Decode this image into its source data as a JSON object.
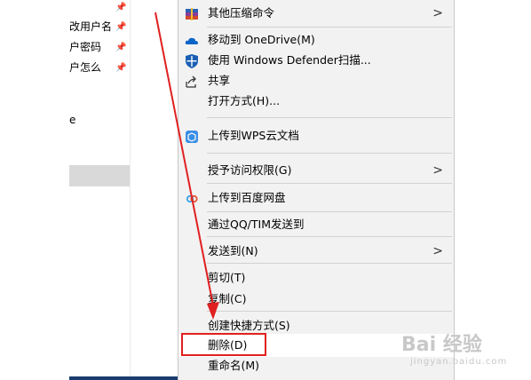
{
  "explorer": {
    "quick_access": [
      {
        "label": "",
        "pinned": true
      },
      {
        "label": "改用户名",
        "pinned": true
      },
      {
        "label": "户密码",
        "pinned": true
      },
      {
        "label": "户怎么",
        "pinned": true
      }
    ],
    "partial_item": "e"
  },
  "menu": {
    "items": [
      {
        "label": "其他压缩命令",
        "icon": "archive-icon",
        "submenu": true
      },
      {
        "label": "移动到 OneDrive(M)",
        "icon": "onedrive-cloud-icon",
        "submenu": false
      },
      {
        "label": "使用 Windows Defender扫描...",
        "icon": "defender-shield-icon",
        "submenu": false
      },
      {
        "label": "共享",
        "icon": "share-icon",
        "submenu": false
      },
      {
        "label": "打开方式(H)...",
        "icon": "",
        "submenu": false
      },
      {
        "label": "上传到WPS云文档",
        "icon": "wps-cloud-icon",
        "submenu": false
      },
      {
        "label": "授予访问权限(G)",
        "icon": "",
        "submenu": true
      },
      {
        "label": "上传到百度网盘",
        "icon": "baidu-netdisk-icon",
        "submenu": false
      },
      {
        "label": "通过QQ/TIM发送到",
        "icon": "",
        "submenu": false
      },
      {
        "label": "发送到(N)",
        "icon": "",
        "submenu": true
      },
      {
        "label": "剪切(T)",
        "icon": "",
        "submenu": false
      },
      {
        "label": "复制(C)",
        "icon": "",
        "submenu": false
      },
      {
        "label": "创建快捷方式(S)",
        "icon": "",
        "submenu": false
      },
      {
        "label": "删除(D)",
        "icon": "",
        "submenu": false
      },
      {
        "label": "重命名(M)",
        "icon": "",
        "submenu": false
      }
    ],
    "submenu_arrow": ">"
  },
  "annotation": {
    "color": "#e02020",
    "target": "删除(D)"
  },
  "watermark": {
    "text": "Bai 经验",
    "sub": "jingyan.baidu.com"
  },
  "colors": {
    "menu_bg": "#f2f2f2",
    "hover_bg": "#ffffff",
    "selection": "#cce8ff",
    "accent": "#0078d7"
  }
}
